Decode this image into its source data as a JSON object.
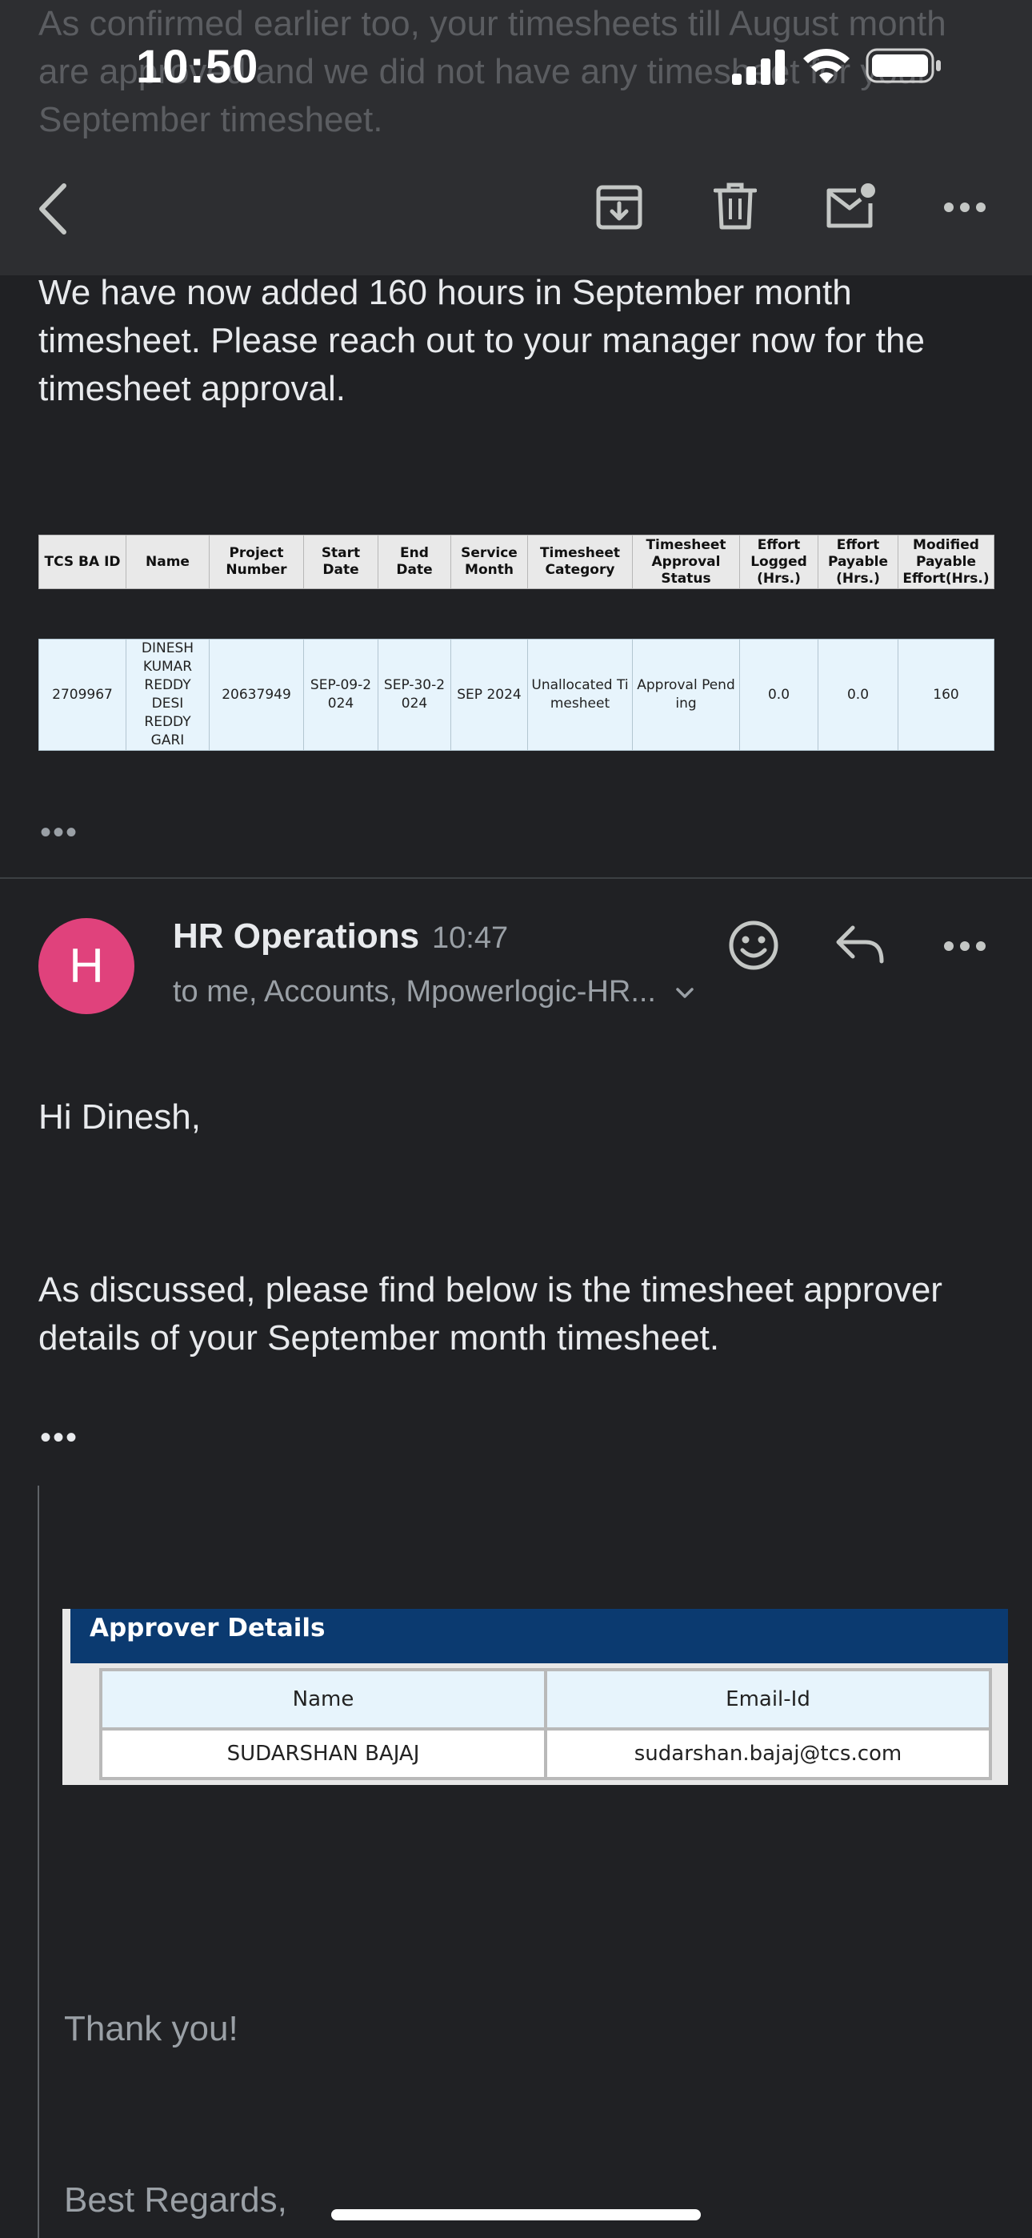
{
  "status_bar": {
    "time": "10:50"
  },
  "ghost_text": "As confirmed earlier too, your timesheets till August month are approved and we did not have any timesheet for your September timesheet.",
  "prev_message": {
    "body": "We have now added 160 hours in September month timesheet. Please reach out to your manager now for the timesheet approval.",
    "table": {
      "headers": [
        "TCS BA ID",
        "Name",
        "Project Number",
        "Start Date",
        "End Date",
        "Service Month",
        "Timesheet Category",
        "Timesheet Approval Status",
        "Effort Logged (Hrs.)",
        "Effort Payable (Hrs.)",
        "Modified Payable Effort(Hrs.)"
      ],
      "row": [
        "2709967",
        "DINESH KUMAR REDDY DESI REDDY GARI",
        "20637949",
        "SEP-09-2024",
        "SEP-30-2024",
        "SEP 2024",
        "Unallocated Timesheet",
        "Approval Pending",
        "0.0",
        "0.0",
        "160"
      ]
    },
    "more": "•••"
  },
  "message": {
    "avatar_letter": "H",
    "sender": "HR Operations",
    "time": "10:47",
    "recipients": "to me, Accounts, Mpowerlogic-HR...",
    "greeting": "Hi Dinesh,",
    "body": "As discussed, please find below is the timesheet approver details of your September month timesheet.",
    "more": "•••",
    "approver": {
      "title": "Approver Details",
      "col_name": "Name",
      "col_email": "Email-Id",
      "name": "SUDARSHAN BAJAJ",
      "email": "sudarshan.bajaj@tcs.com"
    },
    "thanks": "Thank you!",
    "regards": "Best Regards,"
  },
  "icons": {
    "back": "back-chevron-icon",
    "archive": "archive-icon",
    "delete": "trash-icon",
    "mark_unread": "mark-unread-icon",
    "more": "more-horizontal-icon",
    "emoji": "emoji-icon",
    "reply": "reply-icon"
  },
  "colors": {
    "avatar": "#e0427c",
    "approver_header": "#0b3a70",
    "background": "#202124"
  }
}
